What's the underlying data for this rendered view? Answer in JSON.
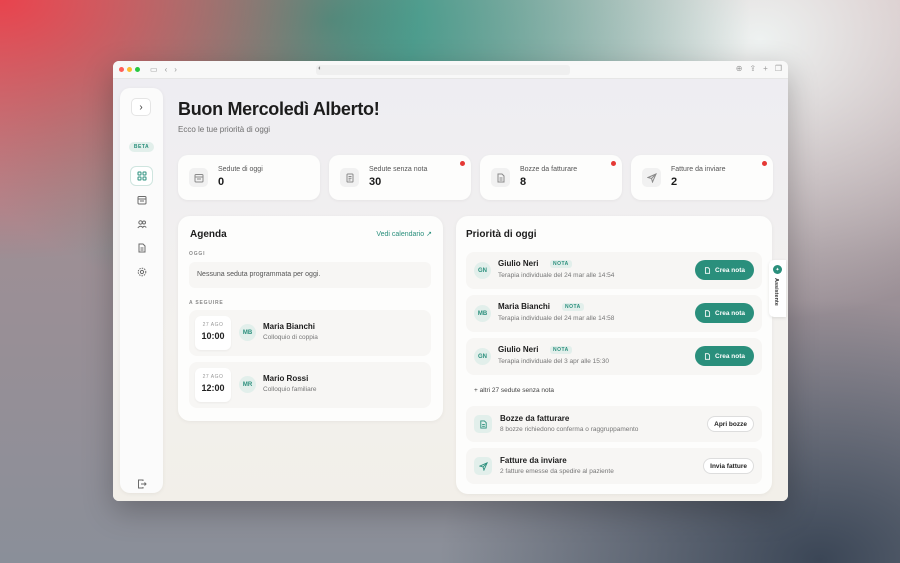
{
  "greeting": "Buon Mercoledì Alberto!",
  "subtitle": "Ecco le tue priorità di oggi",
  "sidebar": {
    "beta_label": "BETA",
    "items": [
      {
        "icon": "grid-icon"
      },
      {
        "icon": "calendar-icon"
      },
      {
        "icon": "users-icon"
      },
      {
        "icon": "document-icon"
      },
      {
        "icon": "gear-icon"
      },
      {
        "icon": "logout-icon"
      }
    ]
  },
  "stats": [
    {
      "label": "Sedute di oggi",
      "value": "0",
      "icon": "calendar-icon",
      "alert": false
    },
    {
      "label": "Sedute senza nota",
      "value": "30",
      "icon": "note-icon",
      "alert": true
    },
    {
      "label": "Bozze da fatturare",
      "value": "8",
      "icon": "document-icon",
      "alert": true
    },
    {
      "label": "Fatture da inviare",
      "value": "2",
      "icon": "send-icon",
      "alert": true
    }
  ],
  "agenda": {
    "title": "Agenda",
    "calendar_link": "Vedi calendario ↗",
    "today_label": "OGGI",
    "empty_text": "Nessuna seduta programmata per oggi.",
    "next_label": "A SEGUIRE",
    "appointments": [
      {
        "date": "27 AGO",
        "time": "10:00",
        "initials": "MB",
        "name": "Maria Bianchi",
        "type": "Colloquio di coppia"
      },
      {
        "date": "27 AGO",
        "time": "12:00",
        "initials": "MR",
        "name": "Mario Rossi",
        "type": "Colloquio familiare"
      }
    ]
  },
  "priorities": {
    "title": "Priorità di oggi",
    "sessions": [
      {
        "initials": "GN",
        "name": "Giulio Neri",
        "badge": "NOTA",
        "desc": "Terapia individuale del 24 mar alle 14:54",
        "action": "Crea nota"
      },
      {
        "initials": "MB",
        "name": "Maria Bianchi",
        "badge": "NOTA",
        "desc": "Terapia individuale del 24 mar alle 14:58",
        "action": "Crea nota"
      },
      {
        "initials": "GN",
        "name": "Giulio Neri",
        "badge": "NOTA",
        "desc": "Terapia individuale del 3 apr alle 15:30",
        "action": "Crea nota"
      }
    ],
    "more_text": "+ altri 27 sedute senza nota",
    "actions": [
      {
        "title": "Bozze da fatturare",
        "desc": "8 bozze richiedono conferma o raggruppamento",
        "button": "Apri bozze",
        "icon": "document-icon"
      },
      {
        "title": "Fatture da inviare",
        "desc": "2 fatture emesse da spedire al paziente",
        "button": "Invia fatture",
        "icon": "send-icon"
      }
    ]
  },
  "assistant": {
    "label": "Assistente"
  },
  "colors": {
    "accent": "#2a8f7c",
    "alert": "#e53935",
    "accent_light": "#e2efeb"
  }
}
